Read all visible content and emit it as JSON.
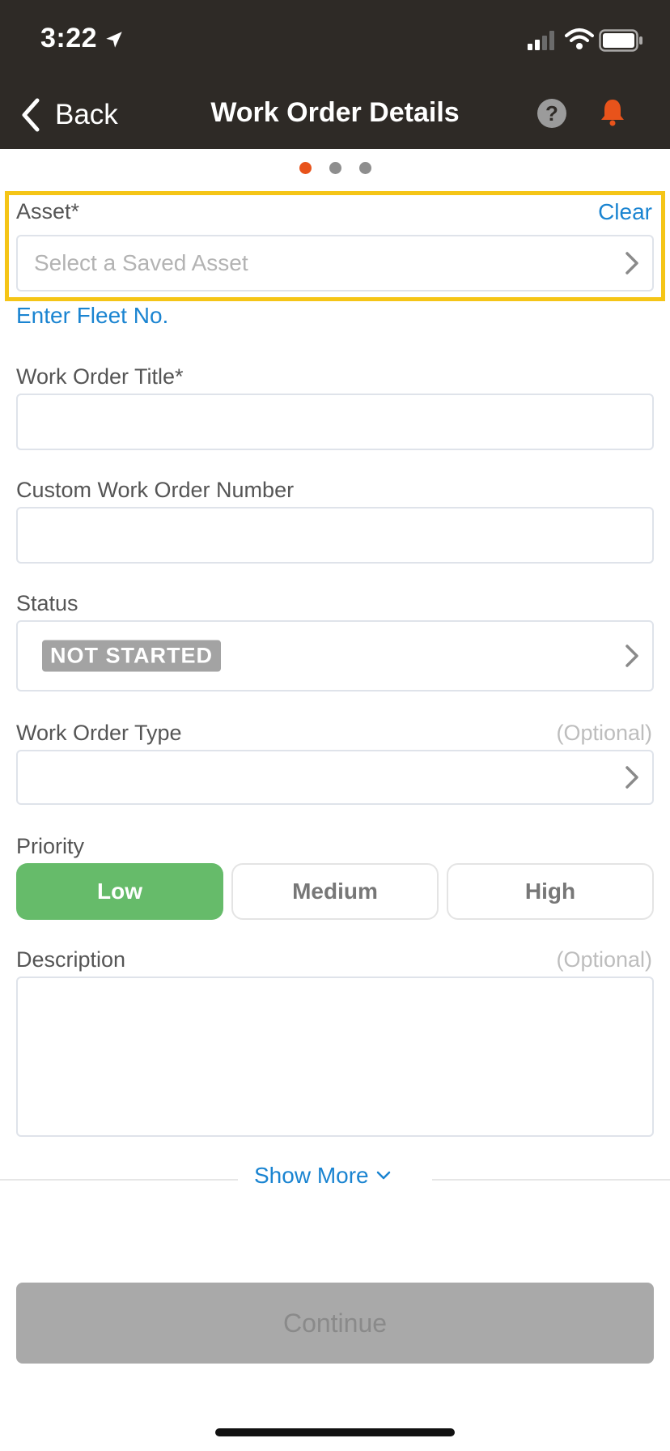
{
  "status_bar": {
    "time": "3:22"
  },
  "nav": {
    "back_label": "Back",
    "title": "Work Order Details",
    "help_glyph": "?"
  },
  "pager": {
    "count": 3,
    "active_index": 0
  },
  "asset": {
    "label": "Asset*",
    "clear_label": "Clear",
    "placeholder": "Select a Saved Asset",
    "fleet_link": "Enter Fleet No."
  },
  "title_field": {
    "label": "Work Order Title*",
    "value": ""
  },
  "custom_number": {
    "label": "Custom Work Order Number",
    "value": ""
  },
  "status": {
    "label": "Status",
    "value": "NOT STARTED"
  },
  "wo_type": {
    "label": "Work Order Type",
    "optional": "(Optional)",
    "value": ""
  },
  "priority": {
    "label": "Priority",
    "options": [
      "Low",
      "Medium",
      "High"
    ],
    "selected": "Low"
  },
  "description": {
    "label": "Description",
    "optional": "(Optional)",
    "value": ""
  },
  "show_more_label": "Show More",
  "continue_label": "Continue",
  "colors": {
    "nav_bg": "#2e2a26",
    "accent": "#e8531b",
    "link": "#1a84d1",
    "highlight": "#f5c517",
    "selected_priority": "#66bb6a",
    "disabled_button": "#a9a9a9"
  },
  "icons": {
    "location": "location-arrow-icon",
    "signal": "signal-icon",
    "wifi": "wifi-icon",
    "battery": "battery-icon",
    "back": "chevron-left-icon",
    "help": "help-icon",
    "bell": "bell-icon",
    "chevron": "chevron-right-icon",
    "show_more": "chevron-down-icon"
  }
}
